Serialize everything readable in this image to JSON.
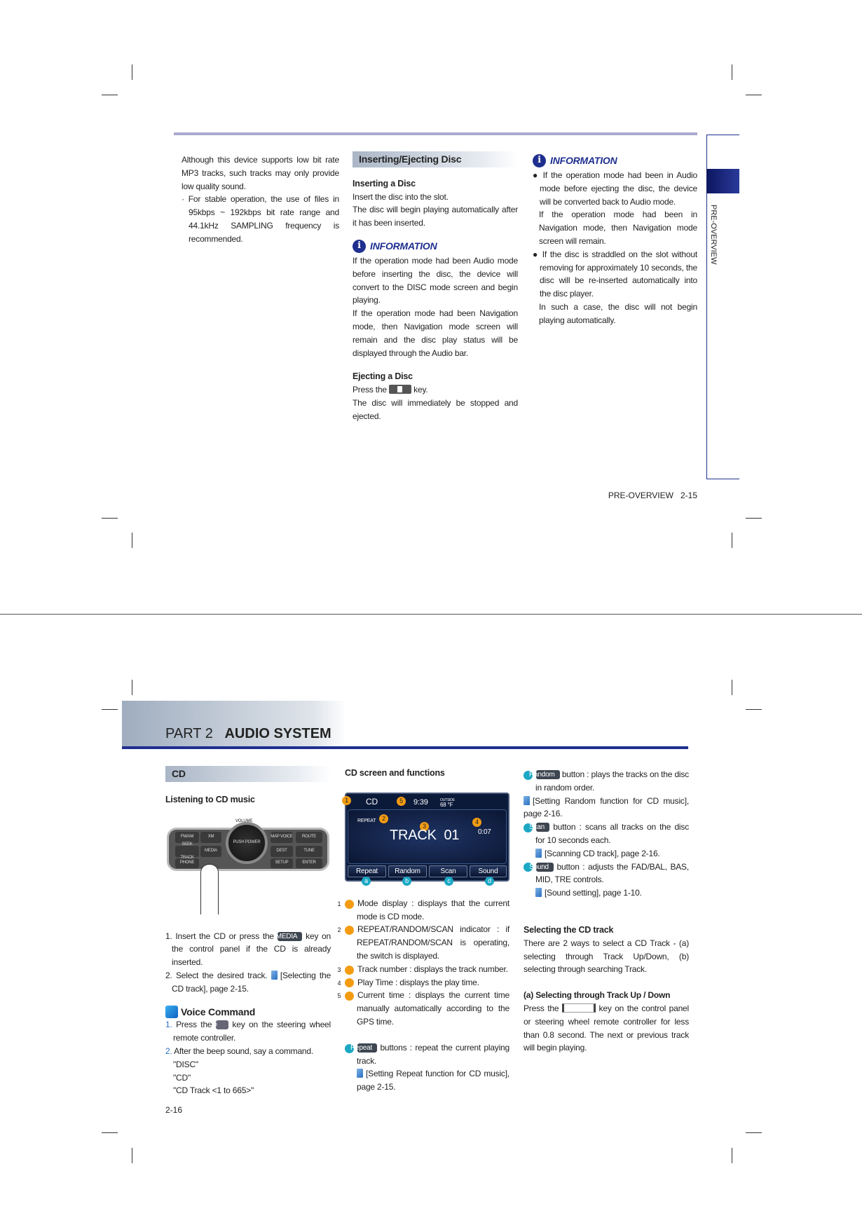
{
  "top_page": {
    "left": [
      "Although this device supports low bit rate MP3 tracks, such tracks may only provide low quality sound.",
      "For stable operation, the use of files in 95kbps ~ 192kbps bit rate range and 44.1kHz SAMPLING frequency is recommended."
    ],
    "mid": {
      "section": "Inserting/Ejecting Disc",
      "insert_heading": "Inserting a Disc",
      "insert_lines": [
        "Insert the disc into the slot.",
        "The disc will begin playing automatically after it has been inserted."
      ],
      "info_title": "INFORMATION",
      "info_paras": [
        "If the operation mode had been Audio mode before inserting the disc, the device will convert to the DISC mode screen and begin playing.",
        "If the operation mode had been Navigation mode, then Navigation mode screen will remain and the disc play status will be displayed through the Audio bar."
      ],
      "eject_heading": "Ejecting a Disc",
      "eject_pre": "Press the",
      "eject_post": "key.",
      "eject_line2": "The disc will immediately be stopped and ejected."
    },
    "right": {
      "info_title": "INFORMATION",
      "b1": "If the operation mode had been in Audio mode before ejecting the disc, the device will be converted back to Audio mode.",
      "b1_cont": "If the operation mode had been in Navigation mode, then Navigation mode screen will remain.",
      "b2": "If the disc is straddled on the slot without removing for approximately 10 seconds, the disc will be re-inserted automatically into the disc player.",
      "b2_cont": "In such a case, the disc will not begin playing automatically."
    },
    "side_tab": "PRE-OVERVIEW",
    "footer_section": "PRE-OVERVIEW",
    "footer_page": "2-15"
  },
  "bottom_page": {
    "part": "PART 2",
    "title": "AUDIO SYSTEM",
    "left": {
      "section": "CD",
      "sub": "Listening to CD music",
      "panel": {
        "volume": "VOLUME",
        "fmam": "FM/AM",
        "xm": "XM",
        "map": "MAP VOICE",
        "route": "ROUTE",
        "seek": "SEEK TRACK",
        "media": "MEDIA",
        "power": "PUSH POWER",
        "dest": "DEST",
        "tune": "TUNE",
        "phone": "PHONE",
        "setup": "SETUP",
        "enter": "ENTER"
      },
      "step1_pre": "1. Insert the CD or press the",
      "step1_key": "MEDIA",
      "step1_post": "key on the control panel if the CD is already inserted.",
      "step2": "2. Select the desired track.",
      "step2_ref": "[Selecting the CD track], page 2-15.",
      "voice_title": "Voice Command",
      "v1_num": "1.",
      "v1_pre": "Press the",
      "v1_post": "key on the steering wheel remote controller.",
      "v2_num": "2.",
      "v2": "After the beep sound, say a command.",
      "commands": [
        "\"DISC\"",
        "\"CD\"",
        "\"CD Track <1 to 665>\""
      ]
    },
    "mid": {
      "heading": "CD screen and functions",
      "screen": {
        "mode": "CD",
        "time": "9:39",
        "outside": "OUTSIDE",
        "temp": "68 °F",
        "repeat": "REPEAT",
        "track": "TRACK  01",
        "playtime": "0:07",
        "buttons": [
          "Repeat",
          "Random",
          "Scan",
          "Sound"
        ]
      },
      "items": [
        {
          "n": "1",
          "text": "Mode display : displays that the current mode is CD mode."
        },
        {
          "n": "2",
          "text": "REPEAT/RANDOM/SCAN indicator : if REPEAT/RANDOM/SCAN is operating, the switch is displayed."
        },
        {
          "n": "3",
          "text": "Track number : displays the track number."
        },
        {
          "n": "4",
          "text": "Play Time : displays the play time."
        },
        {
          "n": "5",
          "text": "Current time : displays the current time manually automatically according to the GPS time."
        }
      ],
      "a": {
        "l": "a",
        "key": "Repeat",
        "text": "buttons : repeat the current playing track.",
        "ref": "[Setting Repeat function for CD music], page 2-15."
      }
    },
    "right": {
      "b": {
        "l": "b",
        "key": "Random",
        "text": "button : plays the tracks on the disc in random order.",
        "ref": "[Setting Random function for CD music], page 2-16."
      },
      "c": {
        "l": "c",
        "key": "Scan",
        "text": "button : scans all tracks on the disc for 10 seconds each.",
        "ref": "[Scanning CD track], page 2-16."
      },
      "d": {
        "l": "d",
        "key": "Sound",
        "text": "button : adjusts the FAD/BAL, BAS, MID, TRE controls.",
        "ref": "[Sound setting], page 1-10."
      },
      "sel_heading": "Selecting the CD track",
      "sel_text": "There are 2 ways to select a CD Track - (a) selecting through Track Up/Down, (b) selecting through searching Track.",
      "sub_heading": "(a) Selecting through Track Up / Down",
      "press_pre": "Press the",
      "press_post": "key on the control panel or steering wheel remote controller for less than 0.8 second. The next or previous track will begin playing."
    },
    "page": "2-16"
  },
  "colors": {
    "accent": "#1f2f8f",
    "badge_number": "#f39c12",
    "badge_letter": "#1ba8c4",
    "rule": "#a9a9cf"
  }
}
